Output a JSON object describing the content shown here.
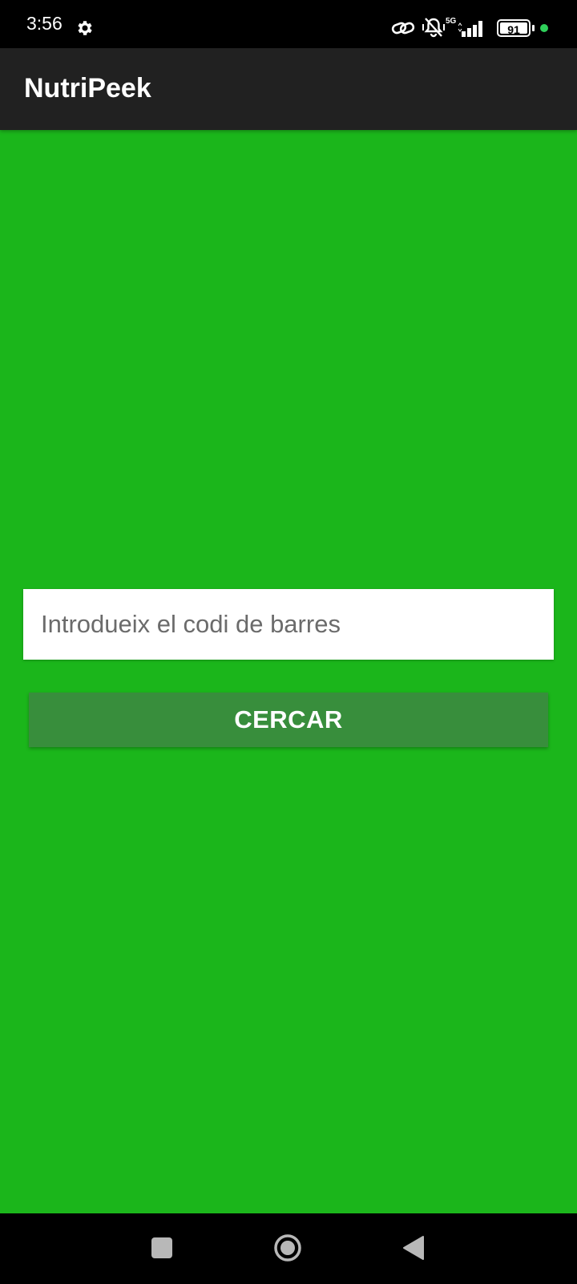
{
  "status_bar": {
    "time": "3:56",
    "battery_level": "91",
    "network_label": "5G",
    "icons": [
      "settings-gear-icon",
      "link-icon",
      "silent-mode-icon",
      "signal-icon",
      "battery-icon",
      "privacy-dot-icon"
    ],
    "privacy_dot_color": "#2fd05a"
  },
  "app_bar": {
    "title": "NutriPeek",
    "background_color": "#212121"
  },
  "main": {
    "background_color": "#1bb61b",
    "barcode_input": {
      "placeholder": "Introdueix el codi de barres",
      "value": ""
    },
    "search_button": {
      "label": "CERCAR",
      "color": "#388e3c"
    }
  },
  "nav_bar": {
    "buttons": [
      "recents-icon",
      "home-icon",
      "back-icon"
    ]
  }
}
